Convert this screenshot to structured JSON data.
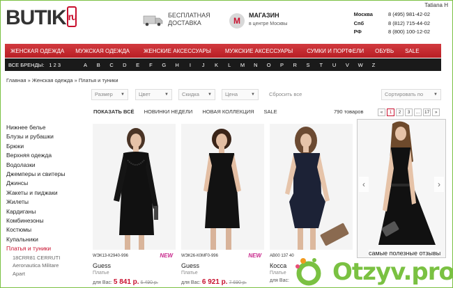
{
  "header": {
    "logo": "BUTIK",
    "logo_tag": "ru",
    "user_name": "Tatiana H",
    "promo_delivery_line1": "БЕСПЛАТНАЯ",
    "promo_delivery_line2": "ДОСТАВКА",
    "promo_store_line1": "МАГАЗИН",
    "promo_store_line2": "в центре Москвы",
    "phones": [
      {
        "city": "Москва",
        "number": "8 (495) 981-42-02"
      },
      {
        "city": "Спб",
        "number": "8 (812) 715-44-02"
      },
      {
        "city": "РФ",
        "number": "8 (800) 100-12-02"
      }
    ]
  },
  "nav": [
    "ЖЕНСКАЯ ОДЕЖДА",
    "МУЖСКАЯ ОДЕЖДА",
    "ЖЕНСКИЕ АКСЕССУАРЫ",
    "МУЖСКИЕ АКСЕССУАРЫ",
    "СУМКИ И ПОРТФЕЛИ",
    "ОБУВЬ",
    "SALE"
  ],
  "brands": {
    "label": "ВСЕ БРЕНДЫ:",
    "numbers": "1 2 3",
    "letters": [
      "A",
      "B",
      "C",
      "D",
      "E",
      "F",
      "G",
      "H",
      "I",
      "J",
      "K",
      "L",
      "M",
      "N",
      "O",
      "P",
      "R",
      "S",
      "T",
      "U",
      "V",
      "W",
      "Z"
    ]
  },
  "breadcrumb": "Главная » Женская одежда » Платья и туники",
  "filters": {
    "size": "Размер",
    "color": "Цвет",
    "discount": "Скидка",
    "price": "Цена",
    "reset": "Сбросить все",
    "sort": "Сортировать по"
  },
  "tabs": [
    "ПОКАЗАТЬ ВСЁ",
    "НОВИНКИ НЕДЕЛИ",
    "НОВАЯ КОЛЛЕКЦИЯ",
    "SALE"
  ],
  "count": "790 товаров",
  "pager": [
    "«",
    "1",
    "2",
    "3",
    "...",
    "17",
    "»"
  ],
  "sidebar": {
    "items": [
      "Нижнее белье",
      "Блузы и рубашки",
      "Брюки",
      "Верхняя одежда",
      "Водолазки",
      "Джемперы и свитеры",
      "Джинсы",
      "Жакеты и пиджаки",
      "Жилеты",
      "Кардиганы",
      "Комбинезоны",
      "Костюмы",
      "Купальники"
    ],
    "active": "Платья и туники",
    "brands": [
      "18CRR81 CERRUTI",
      "Aeronautica Militare",
      "Apart"
    ]
  },
  "products": [
    {
      "sku": "WЭК13-К2940-996",
      "new": "NEW",
      "brand": "Guess",
      "kind": "Платье",
      "price_prefix": "для Вас:",
      "price": "5 841 р.",
      "old_price": "6 490 р."
    },
    {
      "sku": "WЭК26-К0MF0-996",
      "new": "NEW",
      "brand": "Guess",
      "kind": "Платье",
      "price_prefix": "для Вас:",
      "price": "6 921 р.",
      "old_price": "7 690 р."
    },
    {
      "sku": "AB00 137 40",
      "new": "",
      "brand": "Косса",
      "kind": "Платье",
      "price_prefix": "для Вас:",
      "price": "",
      "old_price": ""
    }
  ],
  "watermark": {
    "caption": "самые полезные отзывы",
    "site": "Otzyv.pro"
  },
  "colors": {
    "accent": "#c8102e",
    "nav_bg": "#c8262c",
    "brands_bg": "#1a1a1a",
    "watermark": "#7ac142"
  }
}
